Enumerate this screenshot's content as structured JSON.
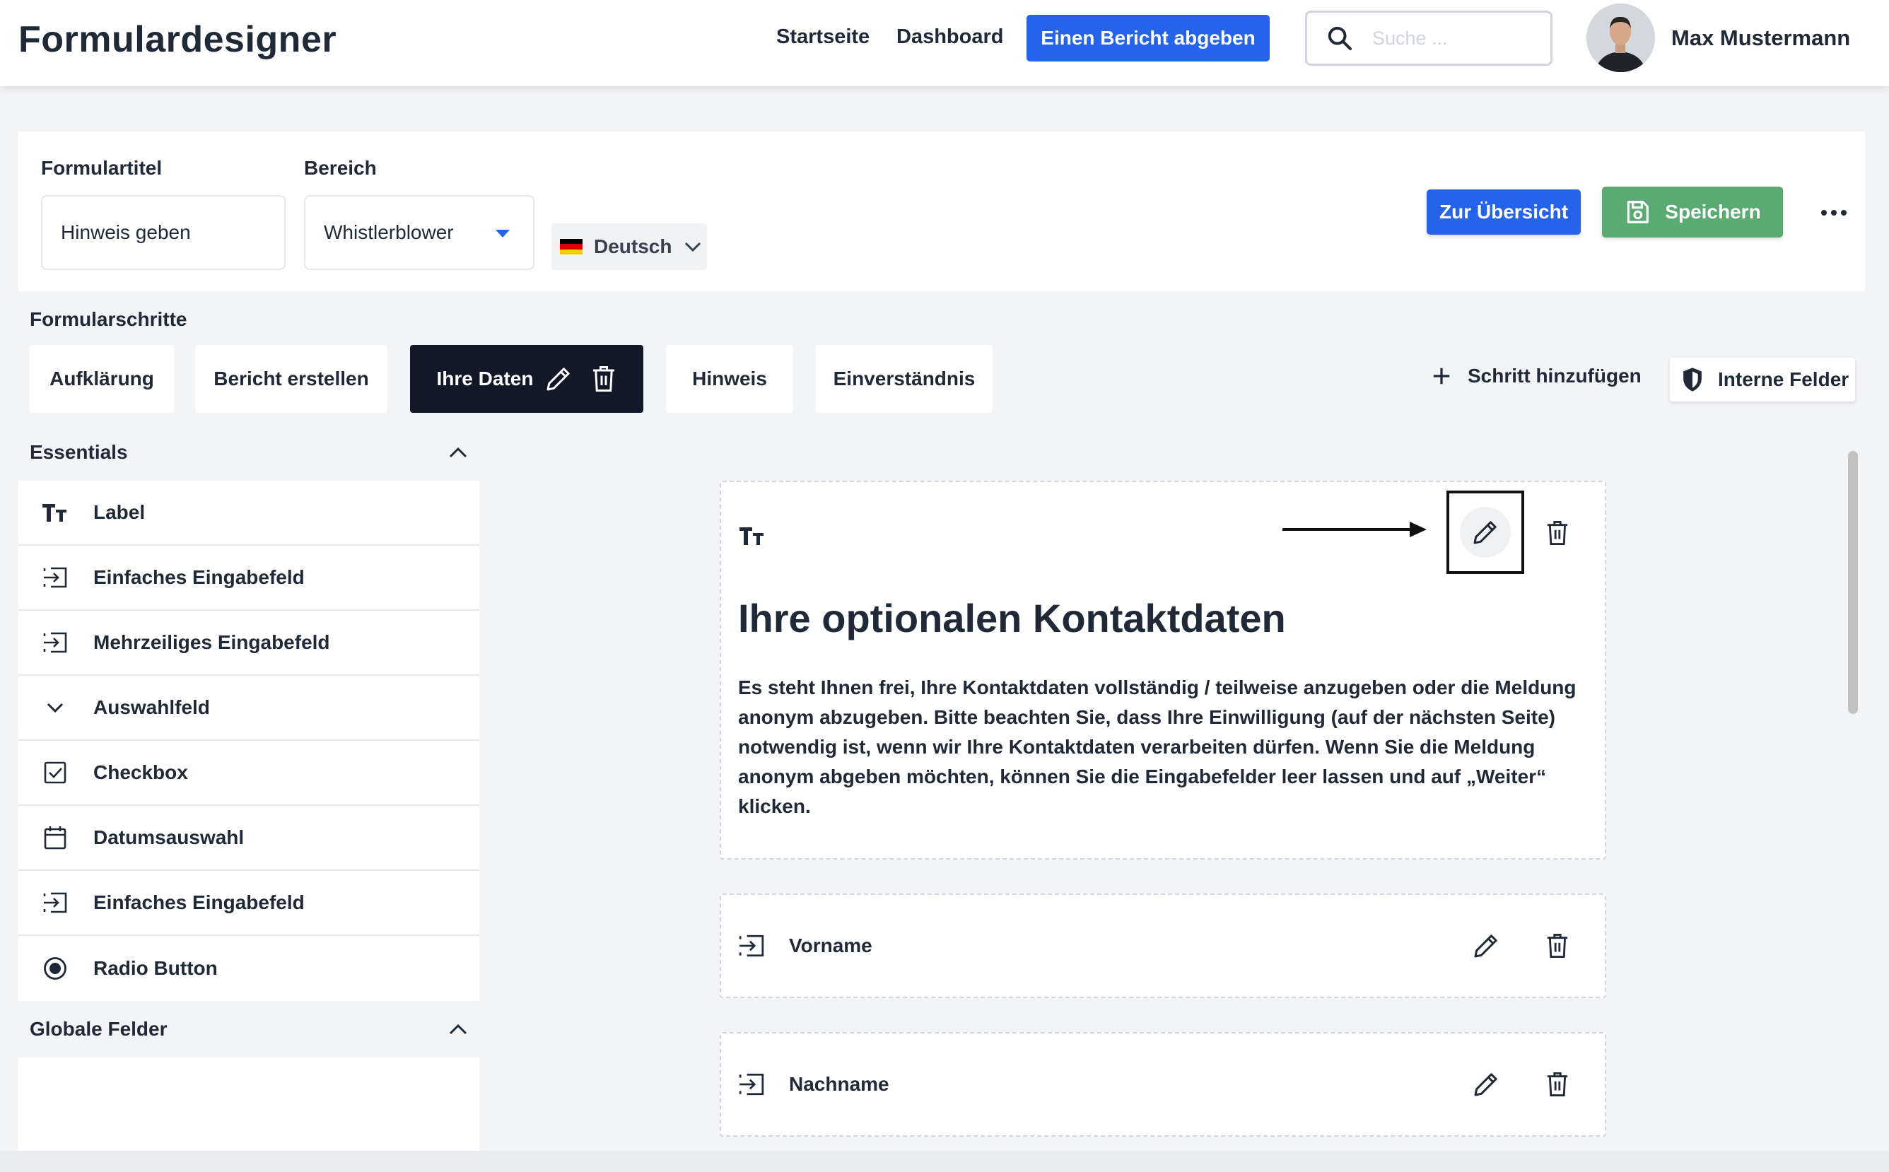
{
  "header": {
    "app_title": "Formulardesigner",
    "nav": [
      "Startseite",
      "Dashboard"
    ],
    "report_button": "Einen Bericht abgeben",
    "search_placeholder": "Suche ...",
    "user_name": "Max Mustermann"
  },
  "form": {
    "title_label": "Formulartitel",
    "title_value": "Hinweis geben",
    "area_label": "Bereich",
    "area_value": "Whistlerblower",
    "language": "Deutsch",
    "overview_button": "Zur Übersicht",
    "save_button": "Speichern"
  },
  "steps": {
    "title": "Formularschritte",
    "items": [
      {
        "label": "Aufklärung"
      },
      {
        "label": "Bericht erstellen"
      },
      {
        "label": "Ihre Daten",
        "active": true
      },
      {
        "label": "Hinweis"
      },
      {
        "label": "Einverständnis"
      }
    ],
    "add_step": "Schritt hinzufügen",
    "internal_fields": "Interne Felder"
  },
  "sidebar": {
    "essentials_title": "Essentials",
    "items": [
      {
        "label": "Label",
        "icon": "text-type-icon"
      },
      {
        "label": "Einfaches Eingabefeld",
        "icon": "input-field-icon"
      },
      {
        "label": "Mehrzeiliges Eingabefeld",
        "icon": "input-field-icon"
      },
      {
        "label": "Auswahlfeld",
        "icon": "chevron-down-icon"
      },
      {
        "label": "Checkbox",
        "icon": "checkbox-icon"
      },
      {
        "label": "Datumsauswahl",
        "icon": "calendar-icon"
      },
      {
        "label": "Einfaches Eingabefeld",
        "icon": "input-field-icon"
      },
      {
        "label": "Radio Button",
        "icon": "radio-icon"
      }
    ],
    "globals_title": "Globale Felder"
  },
  "canvas": {
    "label_card": {
      "heading": "Ihre optionalen Kontaktdaten",
      "text": "Es steht Ihnen frei, Ihre Kontaktdaten vollständig / teilweise anzugeben oder die Meldung anonym abzugeben. Bitte beachten Sie, dass Ihre Einwilligung (auf der nächsten Seite) notwendig ist, wenn wir Ihre Kontaktdaten verarbeiten dürfen. Wenn Sie die Meldung anonym abgeben möchten, können Sie die Eingabefelder leer lassen und auf „Weiter“ klicken."
    },
    "fields": [
      {
        "label": "Vorname"
      },
      {
        "label": "Nachname"
      }
    ]
  },
  "colors": {
    "primary": "#2563eb",
    "save_green": "#5aab73",
    "active_step": "#111827"
  }
}
